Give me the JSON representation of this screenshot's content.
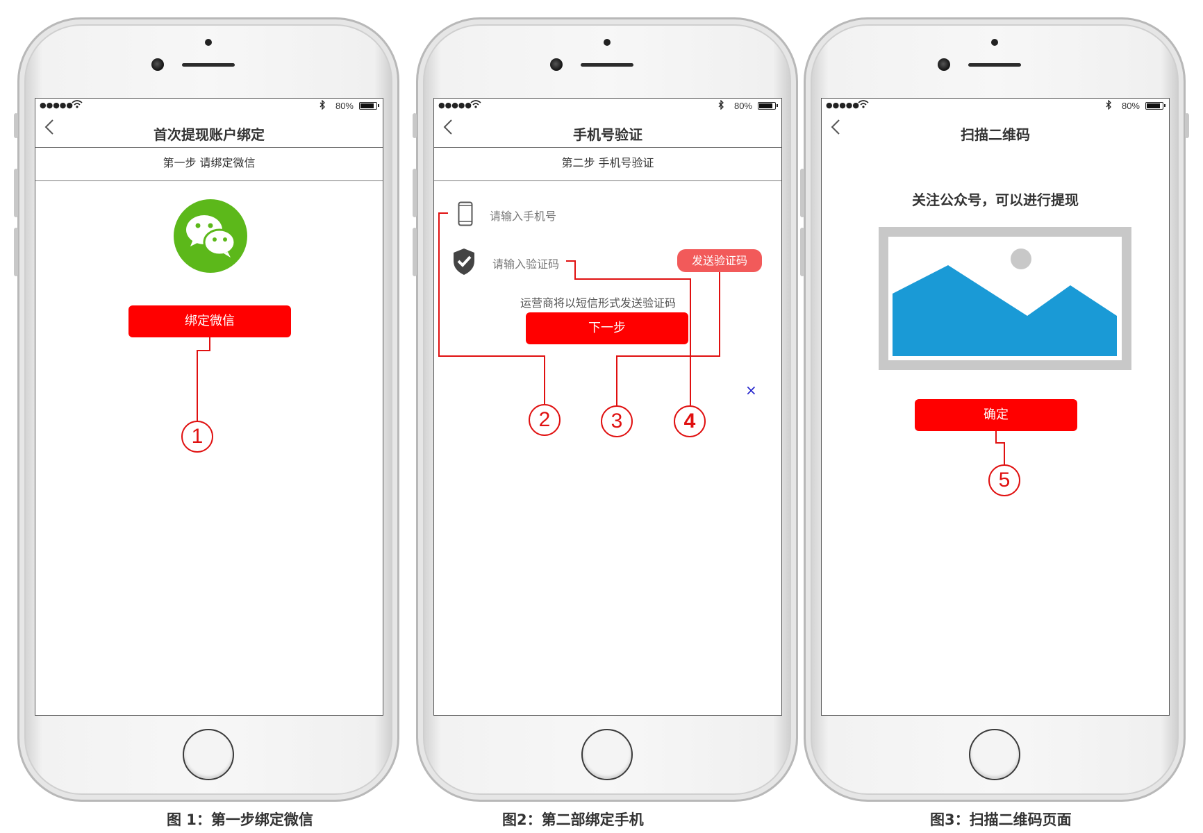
{
  "status_bar": {
    "signal": "●●●●●",
    "battery_pct": "80%",
    "battery_level": 0.8
  },
  "phone1": {
    "title": "首次提现账户绑定",
    "step": "第一步 请绑定微信",
    "bind_button": "绑定微信",
    "callout": "1"
  },
  "phone2": {
    "title": "手机号验证",
    "step": "第二步 手机号验证",
    "phone_placeholder": "请输入手机号",
    "code_placeholder": "请输入验证码",
    "send_code_button": "发送验证码",
    "hint": "运营商将以短信形式发送验证码",
    "next_button": "下一步",
    "callouts": [
      "2",
      "3",
      "4"
    ],
    "close_mark": "×"
  },
  "phone3": {
    "title": "扫描二维码",
    "subtitle": "关注公众号，可以进行提现",
    "confirm_button": "确定",
    "callout": "5"
  },
  "captions": [
    "图 1：第一步绑定微信",
    "图2：第二部绑定手机",
    "图3：扫描二维码页面"
  ],
  "colors": {
    "accent_red": "#ff0000",
    "wechat_green": "#5cb81a",
    "image_blue": "#1a9ad6",
    "send_btn": "#f25a5a"
  }
}
